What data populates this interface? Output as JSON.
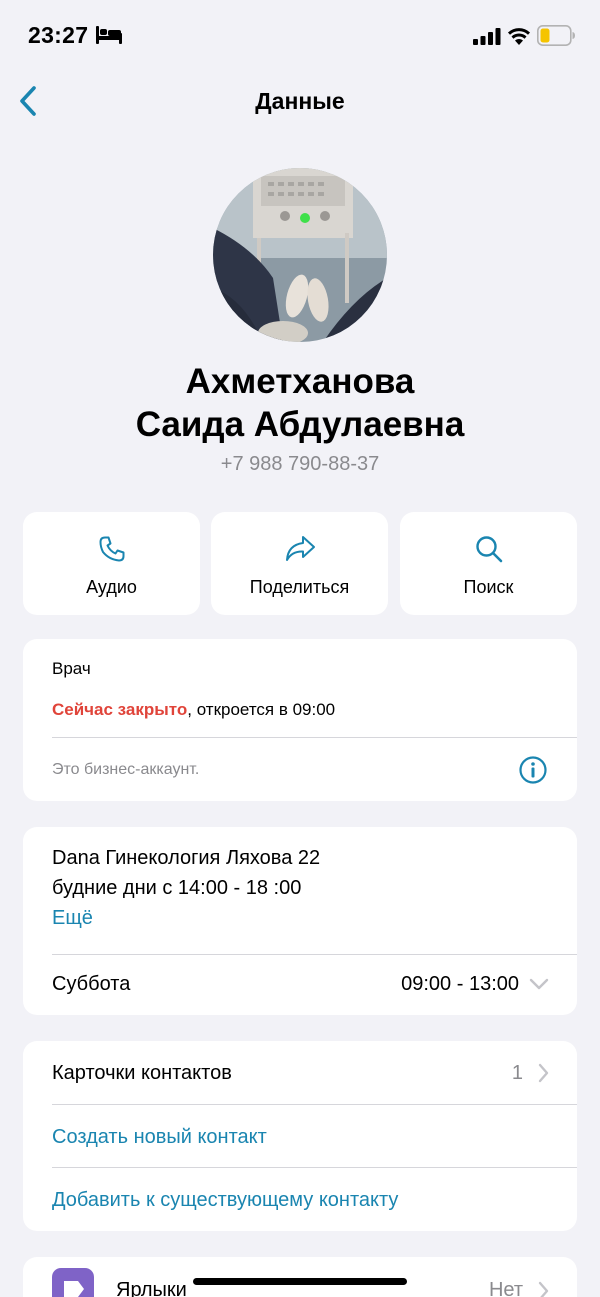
{
  "status_bar": {
    "time": "23:27",
    "battery_color": "#f5c400"
  },
  "nav": {
    "title": "Данные"
  },
  "contact": {
    "name_line1": "Ахметханова",
    "name_line2": "Саида Абдулаевна",
    "phone": "+7 988 790-88-37"
  },
  "actions": [
    {
      "label": "Аудио",
      "icon": "phone-icon"
    },
    {
      "label": "Поделиться",
      "icon": "share-icon"
    },
    {
      "label": "Поиск",
      "icon": "search-icon"
    }
  ],
  "business": {
    "category": "Врач",
    "status_closed": "Сейчас закрыто",
    "status_rest": ", откроется в 09:00",
    "note": "Это бизнес-аккаунт."
  },
  "hours": {
    "address": "Dana Гинекология Ляхова 22",
    "weekdays": "будние дни с 14:00 - 18 :00",
    "more": "Ещё",
    "day": "Суббота",
    "day_hours": "09:00 - 13:00"
  },
  "contacts_card": {
    "cards_label": "Карточки контактов",
    "cards_count": "1",
    "create": "Создать новый контакт",
    "add_existing": "Добавить к существующему контакту"
  },
  "labels_row": {
    "label": "Ярлыки",
    "value": "Нет"
  },
  "colors": {
    "accent": "#1a85b0",
    "closed_red": "#e0443a",
    "background": "#f2f2f7"
  }
}
